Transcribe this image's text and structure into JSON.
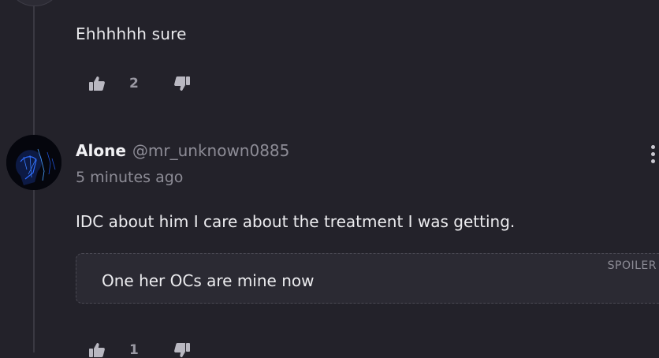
{
  "previous_comment": {
    "body": "Ehhhhhh sure",
    "upvotes": "2"
  },
  "comment": {
    "author_name": "Alone",
    "author_handle": "@mr_unknown0885",
    "timestamp": "5 minutes ago",
    "body": "IDC about him I care about the treatment I was getting.",
    "spoiler_label": "SPOILER",
    "spoiler_text": "One her OCs are mine now",
    "upvotes": "1"
  },
  "icons": [
    "thumbs-up-icon",
    "thumbs-down-icon",
    "more-options-icon"
  ],
  "colors": {
    "background": "#23222a",
    "spoiler_bg": "#2b2a33",
    "muted_text": "#8d8c96"
  }
}
